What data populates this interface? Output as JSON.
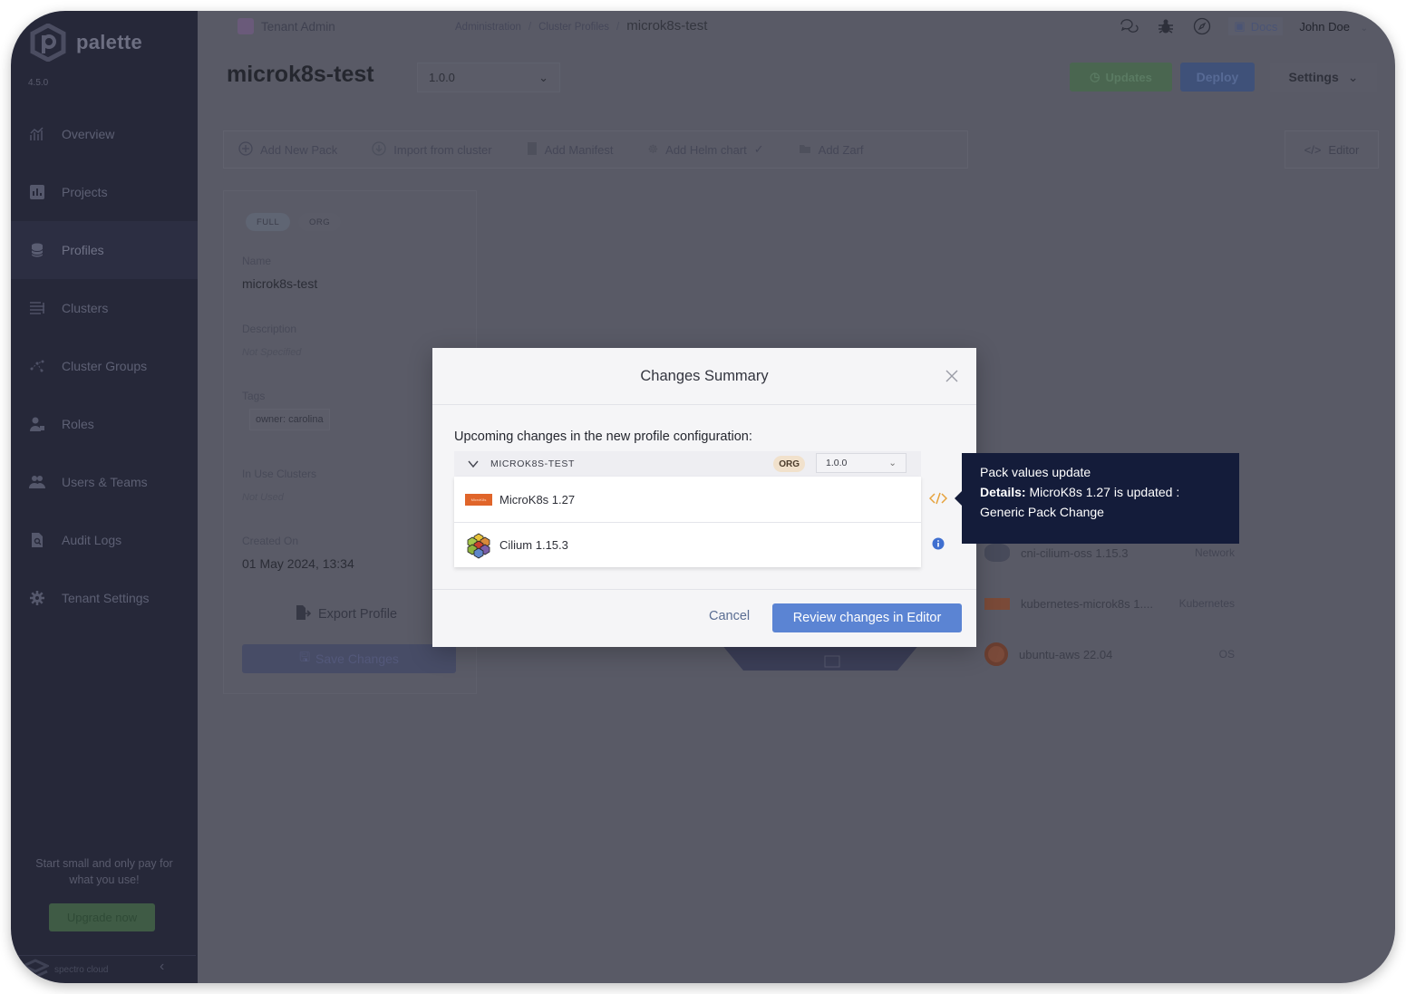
{
  "app": {
    "name": "palette",
    "version": "4.5.0"
  },
  "sidebar": {
    "items": [
      {
        "label": "Overview",
        "icon": "chart-icon"
      },
      {
        "label": "Projects",
        "icon": "bar-chart-icon"
      },
      {
        "label": "Profiles",
        "icon": "database-icon",
        "active": true
      },
      {
        "label": "Clusters",
        "icon": "list-icon"
      },
      {
        "label": "Cluster Groups",
        "icon": "network-icon"
      },
      {
        "label": "Roles",
        "icon": "user-lock-icon"
      },
      {
        "label": "Users & Teams",
        "icon": "users-icon"
      },
      {
        "label": "Audit Logs",
        "icon": "file-search-icon"
      },
      {
        "label": "Tenant Settings",
        "icon": "gear-icon"
      }
    ],
    "promo_text": "Start small and only pay for what you use!",
    "upgrade_label": "Upgrade now",
    "footer_brand": "spectro cloud"
  },
  "topbar": {
    "scope": "Tenant Admin",
    "breadcrumb": [
      "Administration",
      "Cluster Profiles",
      "microk8s-test"
    ],
    "docs_label": "Docs",
    "user_name": "John Doe"
  },
  "header": {
    "title": "microk8s-test",
    "version_selected": "1.0.0",
    "updates_label": "Updates",
    "deploy_label": "Deploy",
    "settings_label": "Settings"
  },
  "toolbar": {
    "items": [
      "Add New Pack",
      "Import from cluster",
      "Add Manifest",
      "Add Helm chart",
      "Add Zarf"
    ],
    "editor_label": "Editor"
  },
  "profile_info": {
    "chips": [
      "FULL",
      "ORG"
    ],
    "name_label": "Name",
    "name_value": "microk8s-test",
    "description_label": "Description",
    "description_value": "Not Specified",
    "tags_label": "Tags",
    "tag": "owner: carolina",
    "in_use_label": "In Use Clusters",
    "in_use_value": "Not Used",
    "created_label": "Created On",
    "created_value": "01 May 2024, 13:34",
    "export_label": "Export Profile",
    "save_label": "Save Changes"
  },
  "layers": [
    {
      "name": "cni-cilium-oss 1.15.3",
      "type": "Network"
    },
    {
      "name": "kubernetes-microk8s 1....",
      "type": "Kubernetes"
    },
    {
      "name": "ubuntu-aws 22.04",
      "type": "OS"
    }
  ],
  "modal": {
    "title": "Changes Summary",
    "subtitle": "Upcoming changes in the new profile configuration:",
    "profile_name": "MICROK8S-TEST",
    "scope_badge": "ORG",
    "version": "1.0.0",
    "packs": [
      {
        "name": "MicroK8s 1.27",
        "status_icon": "code-icon"
      },
      {
        "name": "Cilium 1.15.3",
        "status_icon": "info-icon"
      }
    ],
    "cancel_label": "Cancel",
    "primary_label": "Review changes in Editor"
  },
  "tooltip": {
    "title": "Pack values update",
    "details_label": "Details:",
    "details_text": "MicroK8s 1.27 is updated :",
    "details_text_2": "Generic Pack Change"
  },
  "colors": {
    "sidebar_bg": "#262839",
    "primary": "#5b84d3",
    "tooltip_bg": "#141c3a",
    "code_icon": "#e6a23c",
    "info_icon": "#3f6fd0"
  }
}
